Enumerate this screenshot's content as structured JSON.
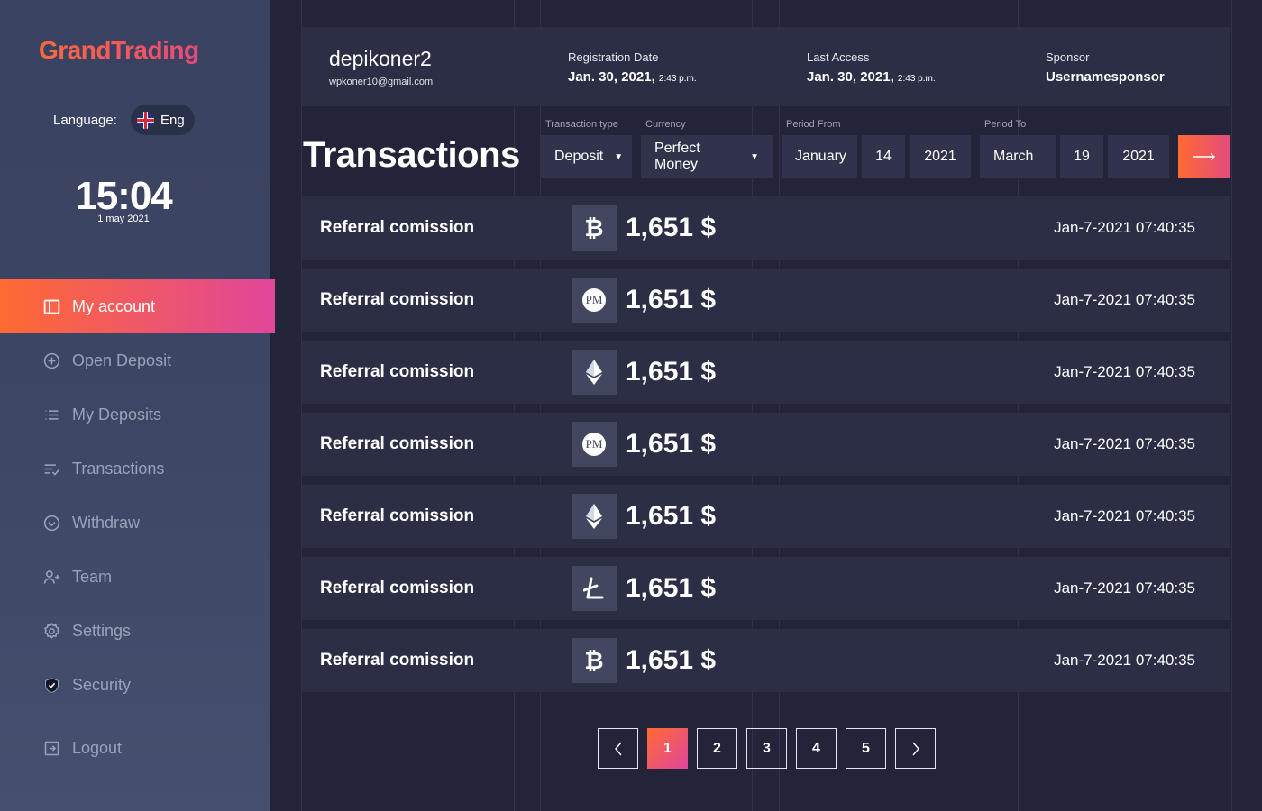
{
  "brand": {
    "logo": "GrandTrading"
  },
  "language": {
    "label": "Language:",
    "value": "Eng"
  },
  "clock": {
    "time": "15:04",
    "date": "1 may 2021"
  },
  "nav": [
    {
      "label": "My account",
      "icon": "account-panel-icon",
      "active": true
    },
    {
      "label": "Open Deposit",
      "icon": "plus-circle-icon"
    },
    {
      "label": "My Deposits",
      "icon": "list-icon"
    },
    {
      "label": "Transactions",
      "icon": "list-check-icon"
    },
    {
      "label": "Withdraw",
      "icon": "check-circle-icon"
    },
    {
      "label": "Team",
      "icon": "user-plus-icon"
    },
    {
      "label": "Settings",
      "icon": "gear-icon"
    },
    {
      "label": "Security",
      "icon": "shield-icon"
    },
    {
      "label": "Logout",
      "icon": "logout-icon"
    }
  ],
  "user": {
    "name": "depikoner2",
    "email": "wpkoner10@gmail.com"
  },
  "meta": {
    "registration": {
      "label": "Registration Date",
      "date": "Jan. 30, 2021,",
      "time": "2:43 p.m."
    },
    "last_access": {
      "label": "Last Access",
      "date": "Jan. 30, 2021,",
      "time": "2:43 p.m."
    },
    "sponsor": {
      "label": "Sponsor",
      "value": "Usernamesponsor"
    }
  },
  "page_title": "Transactions",
  "filters": {
    "type_label": "Transaction type",
    "type_value": "Deposit",
    "currency_label": "Currency",
    "currency_value": "Perfect Money",
    "from_label": "Period From",
    "from_month": "January",
    "from_day": "14",
    "from_year": "2021",
    "to_label": "Period To",
    "to_month": "March",
    "to_day": "19",
    "to_year": "2021"
  },
  "transactions": [
    {
      "label": "Referral comission",
      "coin": "bitcoin-icon",
      "amount": "1,651 $",
      "date": "Jan-7-2021 07:40:35"
    },
    {
      "label": "Referral comission",
      "coin": "perfect-money-icon",
      "amount": "1,651 $",
      "date": "Jan-7-2021 07:40:35"
    },
    {
      "label": "Referral comission",
      "coin": "ethereum-icon",
      "amount": "1,651 $",
      "date": "Jan-7-2021 07:40:35"
    },
    {
      "label": "Referral comission",
      "coin": "perfect-money-icon",
      "amount": "1,651 $",
      "date": "Jan-7-2021 07:40:35"
    },
    {
      "label": "Referral comission",
      "coin": "ethereum-icon",
      "amount": "1,651 $",
      "date": "Jan-7-2021 07:40:35"
    },
    {
      "label": "Referral comission",
      "coin": "litecoin-icon",
      "amount": "1,651 $",
      "date": "Jan-7-2021 07:40:35"
    },
    {
      "label": "Referral comission",
      "coin": "bitcoin-icon",
      "amount": "1,651 $",
      "date": "Jan-7-2021 07:40:35"
    }
  ],
  "pagination": {
    "pages": [
      "1",
      "2",
      "3",
      "4",
      "5"
    ],
    "current": "1",
    "pm_text": "PM"
  },
  "colors": {
    "accent_start": "#ff6a32",
    "accent_end": "#e0469a",
    "background": "#232439",
    "card": "#2c2e46"
  }
}
